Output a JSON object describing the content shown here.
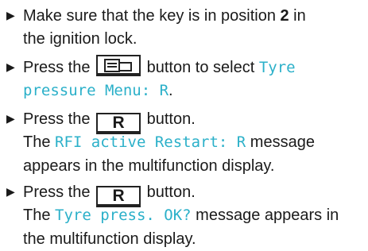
{
  "steps": [
    {
      "line1_text": "Make sure that the key is in position ",
      "line1_bold": "2",
      "line1_tail": " in",
      "line2": "the ignition lock."
    },
    {
      "line1_pre": "Press the ",
      "line1_post": " button to select ",
      "line1_display": "Tyre",
      "line2_display": "pressure Menu: R",
      "line2_tail": "."
    },
    {
      "line1_pre": "Press the ",
      "key_label": "R",
      "line1_post": " button.",
      "line2_pre": "The ",
      "line2_display": "RFI active Restart: R",
      "line2_post": " message",
      "line3": "appears in the multifunction display."
    },
    {
      "line1_pre": "Press the ",
      "key_label": "R",
      "line1_post": " button.",
      "line2_pre": "The ",
      "line2_display": "Tyre press. OK?",
      "line2_post": " message appears in",
      "line3": "the multifunction display."
    }
  ],
  "icons": {
    "bullet": "triangle-bullet-icon",
    "menu_key": "menu-window-key-icon"
  },
  "colors": {
    "display_text": "#2bb0c9",
    "body_text": "#1a1a1a"
  }
}
